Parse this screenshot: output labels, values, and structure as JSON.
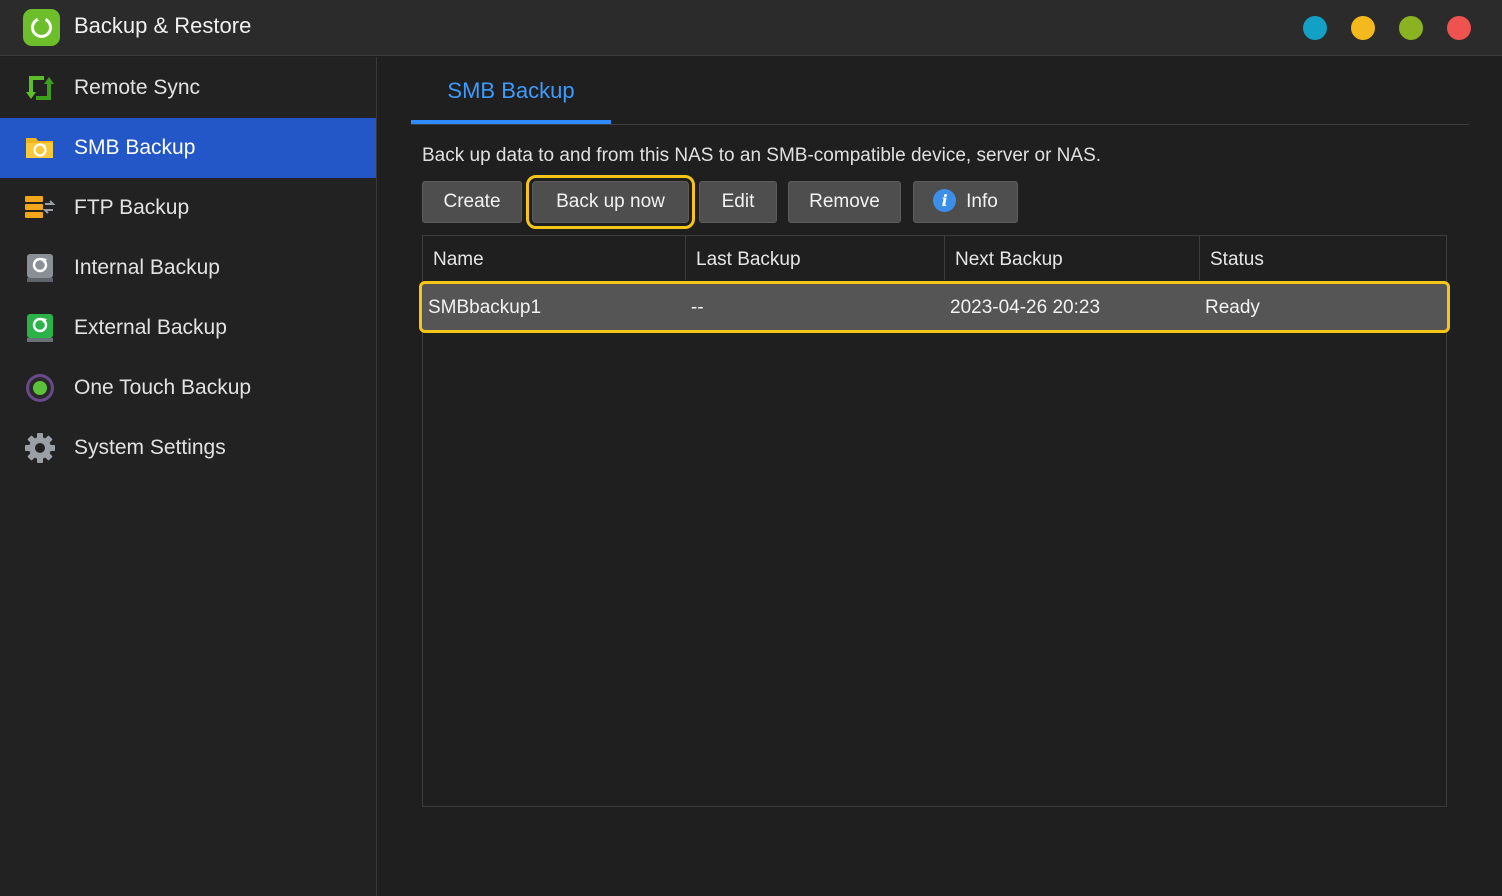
{
  "window": {
    "title": "Backup & Restore",
    "controls": [
      {
        "name": "window-dot-teal",
        "color": "#12a0c4"
      },
      {
        "name": "window-dot-yellow",
        "color": "#f4b91d"
      },
      {
        "name": "window-dot-green",
        "color": "#8bb321"
      },
      {
        "name": "window-dot-red",
        "color": "#ef5350"
      }
    ]
  },
  "sidebar": {
    "items": [
      {
        "label": "Remote Sync",
        "icon": "sync-arrows-icon",
        "active": false
      },
      {
        "label": "SMB Backup",
        "icon": "folder-backup-icon",
        "active": true
      },
      {
        "label": "FTP Backup",
        "icon": "ftp-server-icon",
        "active": false
      },
      {
        "label": "Internal Backup",
        "icon": "internal-drive-icon",
        "active": false
      },
      {
        "label": "External Backup",
        "icon": "external-drive-icon",
        "active": false
      },
      {
        "label": "One Touch Backup",
        "icon": "one-touch-icon",
        "active": false
      },
      {
        "label": "System Settings",
        "icon": "gear-icon",
        "active": false
      }
    ]
  },
  "main": {
    "tab_label": "SMB Backup",
    "description": "Back up data to and from this NAS to an SMB-compatible device, server or NAS.",
    "toolbar": {
      "create": "Create",
      "backup_now": "Back up now",
      "edit": "Edit",
      "remove": "Remove",
      "info": "Info",
      "info_glyph": "i"
    },
    "table": {
      "headers": {
        "name": "Name",
        "last_backup": "Last Backup",
        "next_backup": "Next Backup",
        "status": "Status"
      },
      "rows": [
        {
          "name": "SMBbackup1",
          "last_backup": "--",
          "next_backup": "2023-04-26 20:23",
          "status": "Ready"
        }
      ]
    }
  },
  "colors": {
    "accent": "#2357c8",
    "tab_accent": "#3d9bff",
    "highlight": "#f5c518"
  }
}
